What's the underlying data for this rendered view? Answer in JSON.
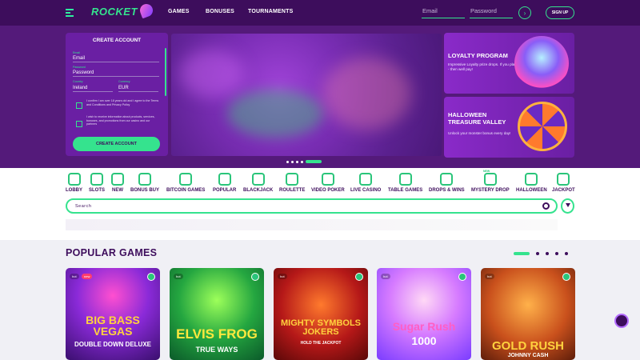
{
  "header": {
    "logo": "ROCKET",
    "nav": [
      "GAMES",
      "BONUSES",
      "TOURNAMENTS"
    ],
    "email_placeholder": "Email",
    "password_placeholder": "Password",
    "signup": "SIGN UP"
  },
  "create_account": {
    "title": "CREATE ACCOUNT",
    "email_label": "Email",
    "email_value": "Email",
    "password_label": "Password",
    "password_value": "Password",
    "country_label": "Country",
    "country_value": "Ireland",
    "currency_label": "Currency",
    "currency_value": "EUR",
    "terms_text": "I confirm I am over 18 years old and I agree to the Terms and Conditions and Privacy Policy",
    "promo_text": "I wish to receive information about products, services, bonuses, and promotions from our casino and our partners",
    "button": "CREATE ACCOUNT"
  },
  "promos": [
    {
      "title": "LOYALTY PROGRAM",
      "text": "Impressive Loyalty prize drops. If you play - then well pay!"
    },
    {
      "title": "HALLOWEEN TREASURE VALLEY",
      "text": "Unlock your monster bonus every day!"
    }
  ],
  "categories": [
    "LOBBY",
    "SLOTS",
    "NEW",
    "BONUS BUY",
    "BITCOIN GAMES",
    "POPULAR",
    "BLACKJACK",
    "ROULETTE",
    "VIDEO POKER",
    "LIVE CASINO",
    "TABLE GAMES",
    "DROPS & WINS",
    "MYSTERY DROP",
    "HALLOWEEN",
    "JACKPOT"
  ],
  "category_badge": "NEW",
  "search_placeholder": "Search",
  "popular": {
    "title": "POPULAR GAMES",
    "games": [
      {
        "tag": "hot",
        "tag2": "new",
        "title": "BIG BASS VEGAS",
        "sub": "DOUBLE DOWN DELUXE"
      },
      {
        "tag": "hot",
        "title": "ELVIS FROG",
        "sub": "TRUE WAYS"
      },
      {
        "tag": "hot",
        "title": "MIGHTY SYMBOLS JOKERS",
        "sub": "HOLD THE JACKPOT"
      },
      {
        "tag": "hot",
        "title": "Sugar Rush",
        "sub": "1000"
      },
      {
        "tag": "hot",
        "title": "GOLD RUSH",
        "sub": "JOHNNY CASH"
      }
    ]
  },
  "colors": {
    "brand_purple": "#3d0d5c",
    "accent_green": "#35e38e"
  }
}
